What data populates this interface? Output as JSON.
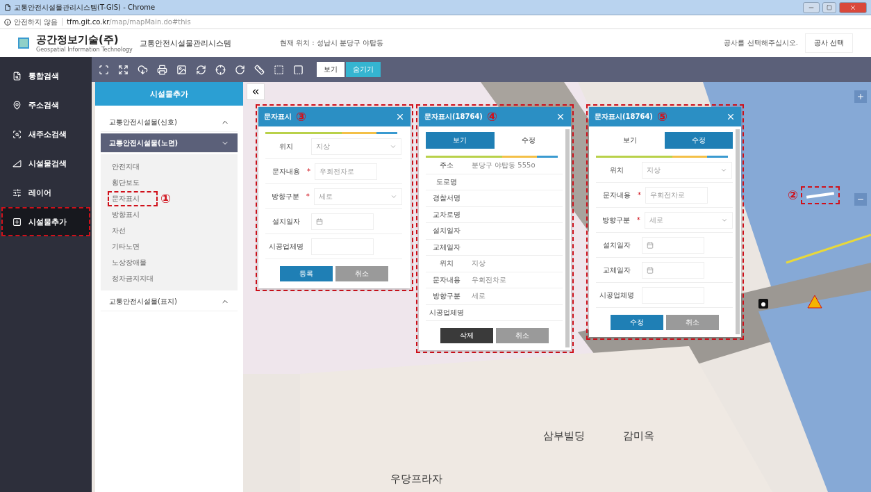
{
  "window": {
    "title": "교통안전시설물관리시스템(T-GIS) - Chrome"
  },
  "address_bar": {
    "security": "안전하지 않음",
    "host": "tfm.git.co.kr",
    "path": "/map/mapMain.do#this"
  },
  "header": {
    "logo": "공간정보기술(주)",
    "logo_sub": "Geospatial Information Technology",
    "system": "교통안전시설물관리시스템",
    "location": "현재 위치 : 성남시 분당구 야탑동",
    "prompt": "공사를 선택해주십시오.",
    "button": "공사 선택"
  },
  "sidebar": {
    "items": [
      {
        "label": "통합검색",
        "selected": false,
        "annotated": false
      },
      {
        "label": "주소검색",
        "selected": false,
        "annotated": false
      },
      {
        "label": "새주소검색",
        "selected": false,
        "annotated": false
      },
      {
        "label": "시설물검색",
        "selected": false,
        "annotated": false
      },
      {
        "label": "레이어",
        "selected": false,
        "annotated": false
      },
      {
        "label": "시설물추가",
        "selected": true,
        "annotated": true
      }
    ]
  },
  "toolbar": {
    "toggles": [
      {
        "label": "보기",
        "selected": false
      },
      {
        "label": "숨기기",
        "selected": true
      }
    ]
  },
  "panel": {
    "title": "시설물추가",
    "groups": [
      {
        "label": "교통안전시설물(신호)",
        "expanded": false
      },
      {
        "label": "교통안전시설물(노면)",
        "expanded": true,
        "items": [
          {
            "label": "안전지대",
            "annotated": false
          },
          {
            "label": "횡단보도",
            "annotated": false
          },
          {
            "label": "문자표시",
            "annotated": true,
            "marker": "①"
          },
          {
            "label": "방향표시",
            "annotated": false
          },
          {
            "label": "차선",
            "annotated": false
          },
          {
            "label": "기타노면",
            "annotated": false
          },
          {
            "label": "노상장애물",
            "annotated": false
          },
          {
            "label": "정차금지지대",
            "annotated": false
          }
        ]
      },
      {
        "label": "교통안전시설물(표지)",
        "expanded": false
      }
    ]
  },
  "popups": [
    {
      "kind": "form",
      "title": "문자표시",
      "marker": "③",
      "fields": [
        {
          "label": "위치",
          "kind": "select",
          "value": "지상"
        },
        {
          "label": "문자내용",
          "kind": "input",
          "required_mark": "*",
          "value": "우회전차로"
        },
        {
          "label": "방향구분",
          "kind": "select",
          "required_mark": "*",
          "value": "세로"
        },
        {
          "label": "설치일자",
          "kind": "date"
        },
        {
          "label": "시공업체명",
          "kind": "input"
        }
      ],
      "buttons": [
        {
          "label": "등록",
          "kind": "primary"
        },
        {
          "label": "취소",
          "kind": "secondary"
        }
      ]
    },
    {
      "kind": "view",
      "title": "문자표시(18764)",
      "marker": "④",
      "tabs": [
        {
          "label": "보기",
          "selected": true
        },
        {
          "label": "수정",
          "selected": false
        }
      ],
      "rows": [
        {
          "label": "주소",
          "value": "분당구 야탑동 555o"
        },
        {
          "label": "도로명"
        },
        {
          "label": "경찰서명"
        },
        {
          "label": "교차로명"
        },
        {
          "label": "설치일자"
        },
        {
          "label": "교체일자"
        },
        {
          "label": "위치",
          "value": "지상"
        },
        {
          "label": "문자내용",
          "value": "우회전차로"
        },
        {
          "label": "방향구분",
          "value": "세로"
        },
        {
          "label": "시공업체명"
        }
      ],
      "buttons": [
        {
          "label": "삭제",
          "kind": "dark"
        },
        {
          "label": "취소",
          "kind": "secondary"
        }
      ]
    },
    {
      "kind": "form",
      "title": "문자표시(18764)",
      "marker": "⑤",
      "tabs": [
        {
          "label": "보기",
          "selected": false
        },
        {
          "label": "수정",
          "selected": true
        }
      ],
      "fields": [
        {
          "label": "위치",
          "kind": "select",
          "value": "지상"
        },
        {
          "label": "문자내용",
          "kind": "input",
          "required_mark": "*",
          "value": "우회전차로"
        },
        {
          "label": "방향구분",
          "kind": "select",
          "required_mark": "*",
          "value": "세로"
        },
        {
          "label": "설치일자",
          "kind": "date"
        },
        {
          "label": "교체일자",
          "kind": "date"
        },
        {
          "label": "시공업체명",
          "kind": "input"
        }
      ],
      "buttons": [
        {
          "label": "수정",
          "kind": "primary"
        },
        {
          "label": "취소",
          "kind": "secondary"
        }
      ]
    }
  ],
  "map": {
    "marker": "②",
    "labels": [
      {
        "text": "삼부빌딩"
      },
      {
        "text": "감미옥"
      },
      {
        "text": "우당프라자"
      }
    ]
  }
}
